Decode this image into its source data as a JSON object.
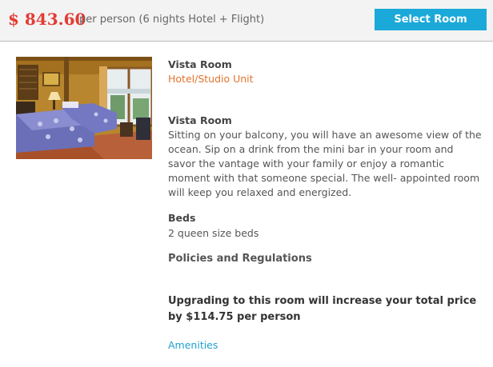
{
  "header": {
    "price": "$ 843.60",
    "price_note": "per person (6 nights Hotel + Flight)",
    "select_label": "Select Room"
  },
  "room": {
    "name": "Vista Room",
    "type": "Hotel/Studio Unit",
    "photo_desc": "room-photo",
    "description_title": "Vista Room",
    "description": "Sitting on your balcony, you will have an awesome view of the ocean. Sip on a drink from the mini bar in your room and savor the vantage with your family or enjoy a romantic moment with that someone special. The well- appointed room will keep you relaxed and energized.",
    "beds_title": "Beds",
    "beds": "2 queen size beds",
    "policies_title": "Policies and Regulations",
    "upgrade_note": "Upgrading to this room will increase your total price by $114.75 per person",
    "amenities_link": "Amenities"
  },
  "colors": {
    "price": "#e33b33",
    "button": "#1aa9d8",
    "room_type": "#e1742e",
    "link": "#21a0cf",
    "header_bg": "#f3f3f3"
  }
}
